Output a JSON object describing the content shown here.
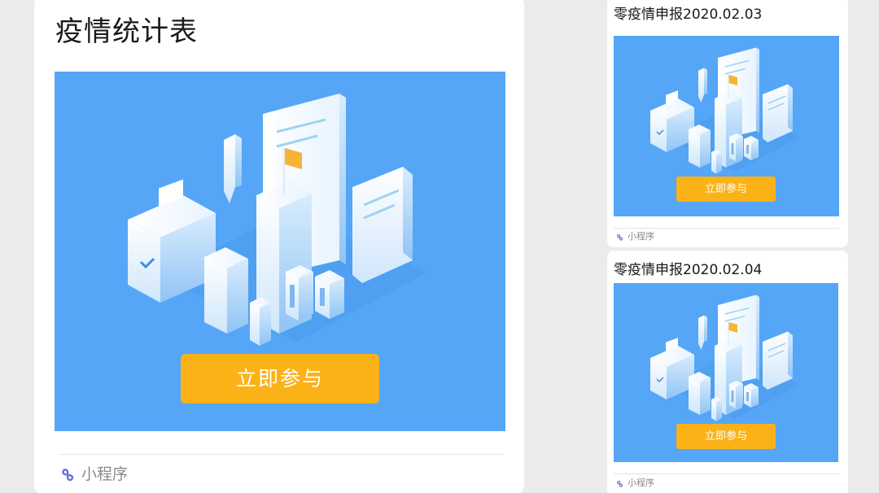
{
  "colors": {
    "page_background": "#ebebeb",
    "card_background": "#ffffff",
    "banner_blue": "#55a6f7",
    "button_orange": "#fbb217",
    "footer_gray": "#8a8a8a",
    "flag_orange": "#f5b434"
  },
  "main_card": {
    "title": "疫情统计表",
    "button_label": "立即参与",
    "footer_label": "小程序",
    "footer_icon": "mini-program-icon"
  },
  "side_cards": [
    {
      "title": "零疫情申报2020.02.03",
      "button_label": "立即参与",
      "footer_label": "小程序",
      "footer_icon": "mini-program-icon"
    },
    {
      "title": "零疫情申报2020.02.04",
      "button_label": "立即参与",
      "footer_label": "小程序",
      "footer_icon": "mini-program-icon"
    }
  ]
}
